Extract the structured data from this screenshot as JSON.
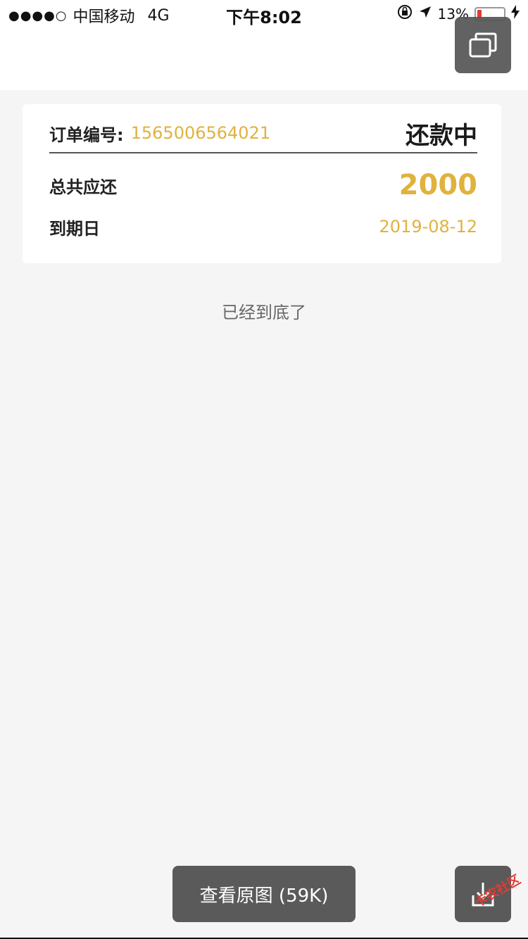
{
  "status_bar": {
    "signal": "●●●●○",
    "carrier": "中国移动",
    "network": "4G",
    "time": "下午8:02",
    "battery_percent": "13%",
    "battery_color": "#e53935"
  },
  "order_card": {
    "order_label": "订单编号:",
    "order_no": "1565006564021",
    "status": "还款中",
    "total_label": "总共应还",
    "total_amount": "2000",
    "due_label": "到期日",
    "due_date": "2019-08-12",
    "accent_color": "#e0b23e"
  },
  "list_end": "已经到底了",
  "viewer": {
    "view_original_label": "查看原图 (59K)",
    "watermark_text": "卡农社区"
  }
}
